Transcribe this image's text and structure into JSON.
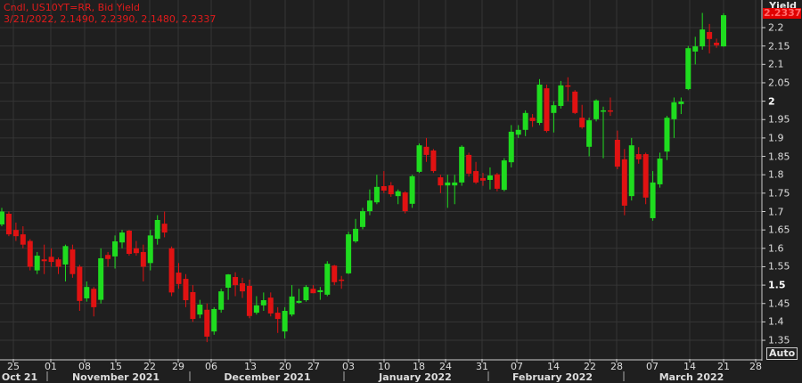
{
  "header": {
    "line1": "Cndl, US10YT=RR, Bid Yield",
    "line2": "3/21/2022, 2.1490, 2.2390, 2.1480, 2.2337"
  },
  "axis": {
    "title": "Yield",
    "current_value": "2.2337",
    "auto_label": "Auto"
  },
  "colors": {
    "up": "#1fdc1f",
    "down": "#e01212",
    "background": "#1f1f1f",
    "grid": "#353535"
  },
  "chart_data": {
    "type": "candlestick",
    "title": "Cndl, US10YT=RR, Bid Yield",
    "ylabel": "Yield",
    "ylim": [
      1.32,
      2.27
    ],
    "yticks": [
      "2.2",
      "2.15",
      "2.1",
      "2.05",
      "2",
      "1.95",
      "1.9",
      "1.85",
      "1.8",
      "1.75",
      "1.7",
      "1.65",
      "1.6",
      "1.55",
      "1.5",
      "1.45",
      "1.4",
      "1.35"
    ],
    "xticks": [
      "25",
      "01",
      "08",
      "15",
      "22",
      "29",
      "06",
      "13",
      "20",
      "27",
      "03",
      "10",
      "18",
      "24",
      "31",
      "07",
      "14",
      "22",
      "28",
      "07",
      "14",
      "21",
      "28"
    ],
    "months": [
      "Oct 21",
      "November 2021",
      "December 2021",
      "January 2022",
      "February 2022",
      "March 2022"
    ],
    "grid": true,
    "candles_ohlc": [
      [
        1.665,
        1.71,
        1.66,
        1.7
      ],
      [
        1.694,
        1.7,
        1.633,
        1.638
      ],
      [
        1.65,
        1.67,
        1.62,
        1.633
      ],
      [
        1.638,
        1.66,
        1.6,
        1.61
      ],
      [
        1.62,
        1.625,
        1.54,
        1.55
      ],
      [
        1.54,
        1.59,
        1.53,
        1.58
      ],
      [
        1.57,
        1.61,
        1.53,
        1.565
      ],
      [
        1.577,
        1.6,
        1.55,
        1.563
      ],
      [
        1.57,
        1.575,
        1.53,
        1.55
      ],
      [
        1.556,
        1.61,
        1.51,
        1.606
      ],
      [
        1.597,
        1.61,
        1.52,
        1.53
      ],
      [
        1.55,
        1.555,
        1.43,
        1.457
      ],
      [
        1.464,
        1.51,
        1.455,
        1.495
      ],
      [
        1.49,
        1.495,
        1.415,
        1.44
      ],
      [
        1.46,
        1.6,
        1.45,
        1.573
      ],
      [
        1.582,
        1.59,
        1.55,
        1.571
      ],
      [
        1.578,
        1.635,
        1.545,
        1.619
      ],
      [
        1.616,
        1.65,
        1.6,
        1.643
      ],
      [
        1.648,
        1.65,
        1.58,
        1.585
      ],
      [
        1.6,
        1.62,
        1.58,
        1.587
      ],
      [
        1.59,
        1.61,
        1.51,
        1.55
      ],
      [
        1.56,
        1.65,
        1.54,
        1.635
      ],
      [
        1.626,
        1.69,
        1.61,
        1.677
      ],
      [
        1.667,
        1.7,
        1.63,
        1.643
      ],
      [
        1.6,
        1.605,
        1.47,
        1.48
      ],
      [
        1.534,
        1.56,
        1.49,
        1.503
      ],
      [
        1.517,
        1.53,
        1.44,
        1.459
      ],
      [
        1.481,
        1.5,
        1.4,
        1.408
      ],
      [
        1.42,
        1.46,
        1.41,
        1.447
      ],
      [
        1.433,
        1.45,
        1.345,
        1.36
      ],
      [
        1.374,
        1.44,
        1.365,
        1.435
      ],
      [
        1.433,
        1.49,
        1.425,
        1.483
      ],
      [
        1.493,
        1.53,
        1.46,
        1.529
      ],
      [
        1.522,
        1.535,
        1.47,
        1.5
      ],
      [
        1.505,
        1.52,
        1.465,
        1.483
      ],
      [
        1.498,
        1.515,
        1.41,
        1.416
      ],
      [
        1.425,
        1.47,
        1.42,
        1.445
      ],
      [
        1.445,
        1.48,
        1.43,
        1.459
      ],
      [
        1.466,
        1.48,
        1.415,
        1.423
      ],
      [
        1.425,
        1.44,
        1.37,
        1.408
      ],
      [
        1.374,
        1.44,
        1.355,
        1.43
      ],
      [
        1.42,
        1.5,
        1.415,
        1.469
      ],
      [
        1.452,
        1.49,
        1.45,
        1.457
      ],
      [
        1.459,
        1.5,
        1.455,
        1.495
      ],
      [
        1.49,
        1.5,
        1.478,
        1.478
      ],
      [
        1.481,
        1.495,
        1.46,
        1.486
      ],
      [
        1.474,
        1.565,
        1.47,
        1.558
      ],
      [
        1.553,
        1.555,
        1.5,
        1.508
      ],
      [
        1.515,
        1.525,
        1.49,
        1.512
      ],
      [
        1.532,
        1.645,
        1.53,
        1.638
      ],
      [
        1.619,
        1.68,
        1.615,
        1.653
      ],
      [
        1.658,
        1.71,
        1.652,
        1.701
      ],
      [
        1.701,
        1.76,
        1.69,
        1.73
      ],
      [
        1.725,
        1.8,
        1.72,
        1.767
      ],
      [
        1.769,
        1.81,
        1.75,
        1.757
      ],
      [
        1.771,
        1.78,
        1.74,
        1.747
      ],
      [
        1.742,
        1.76,
        1.72,
        1.755
      ],
      [
        1.752,
        1.755,
        1.695,
        1.701
      ],
      [
        1.721,
        1.8,
        1.71,
        1.796
      ],
      [
        1.808,
        1.885,
        1.805,
        1.88
      ],
      [
        1.876,
        1.9,
        1.835,
        1.854
      ],
      [
        1.866,
        1.87,
        1.805,
        1.81
      ],
      [
        1.793,
        1.8,
        1.75,
        1.771
      ],
      [
        1.771,
        1.8,
        1.71,
        1.779
      ],
      [
        1.771,
        1.8,
        1.72,
        1.779
      ],
      [
        1.779,
        1.88,
        1.77,
        1.876
      ],
      [
        1.854,
        1.86,
        1.795,
        1.803
      ],
      [
        1.81,
        1.835,
        1.775,
        1.779
      ],
      [
        1.791,
        1.805,
        1.77,
        1.784
      ],
      [
        1.786,
        1.82,
        1.76,
        1.798
      ],
      [
        1.801,
        1.805,
        1.755,
        1.762
      ],
      [
        1.759,
        1.845,
        1.755,
        1.839
      ],
      [
        1.834,
        1.935,
        1.82,
        1.917
      ],
      [
        1.909,
        1.935,
        1.9,
        1.922
      ],
      [
        1.922,
        1.975,
        1.905,
        1.968
      ],
      [
        1.955,
        1.965,
        1.93,
        1.946
      ],
      [
        1.941,
        2.06,
        1.935,
        2.045
      ],
      [
        2.035,
        2.045,
        1.915,
        1.919
      ],
      [
        1.968,
        2.0,
        1.915,
        1.989
      ],
      [
        1.987,
        2.055,
        1.98,
        2.043
      ],
      [
        2.043,
        2.065,
        2.0,
        2.04
      ],
      [
        2.026,
        2.03,
        1.965,
        1.968
      ],
      [
        1.955,
        1.99,
        1.925,
        1.929
      ],
      [
        1.876,
        1.955,
        1.85,
        1.948
      ],
      [
        1.951,
        2.005,
        1.945,
        2.002
      ],
      [
        1.972,
        1.985,
        1.845,
        1.975
      ],
      [
        1.975,
        2.01,
        1.96,
        1.972
      ],
      [
        1.895,
        1.92,
        1.815,
        1.822
      ],
      [
        1.842,
        1.87,
        1.69,
        1.716
      ],
      [
        1.742,
        1.9,
        1.73,
        1.88
      ],
      [
        1.856,
        1.875,
        1.83,
        1.842
      ],
      [
        1.856,
        1.86,
        1.72,
        1.738
      ],
      [
        1.682,
        1.81,
        1.675,
        1.779
      ],
      [
        1.774,
        1.86,
        1.765,
        1.844
      ],
      [
        1.863,
        1.96,
        1.84,
        1.955
      ],
      [
        1.951,
        2.01,
        1.9,
        1.997
      ],
      [
        1.992,
        2.01,
        1.965,
        1.999
      ],
      [
        2.033,
        2.15,
        2.03,
        2.144
      ],
      [
        2.135,
        2.175,
        2.1,
        2.149
      ],
      [
        2.149,
        2.24,
        2.14,
        2.195
      ],
      [
        2.188,
        2.21,
        2.13,
        2.169
      ],
      [
        2.159,
        2.17,
        2.145,
        2.152
      ],
      [
        2.149,
        2.239,
        2.148,
        2.2337
      ]
    ]
  }
}
